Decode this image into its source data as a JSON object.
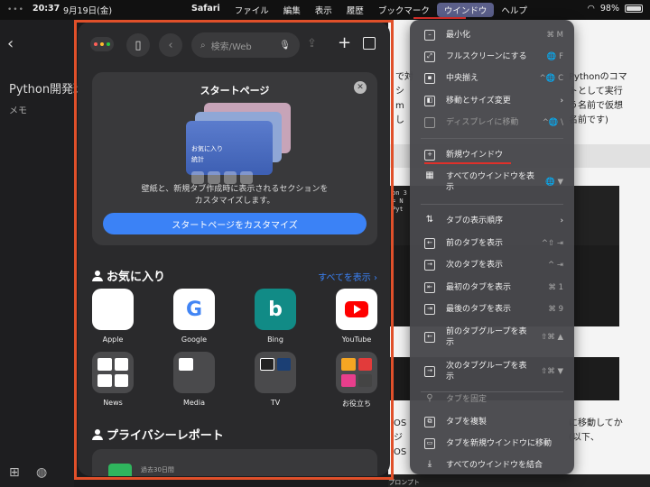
{
  "menubar": {
    "time": "20:37",
    "date": "9月19日(金)",
    "app": "Safari",
    "menus": [
      "ファイル",
      "編集",
      "表示",
      "履歴",
      "ブックマーク",
      "ウインドウ",
      "ヘルプ"
    ],
    "battery": "98%"
  },
  "notes": {
    "title": "Python開発環",
    "subtitle": "メモ"
  },
  "background_page": {
    "line1": "で対",
    "line2": "シ",
    "line3": "m",
    "line4": "し",
    "right1": "Pythonのコマ",
    "right2": "トとして実行",
    "right3": "う名前で仮想",
    "right4": "名前です)",
    "term_line1": "on 3",
    "term_line2": "= N",
    "term_line3": "Pyt",
    "bottom1": "OS",
    "bottom2": "ジ",
    "bottom3": "OS",
    "bottom_right1": "に移動してか",
    "bottom_right2": "(以下、",
    "taskbar_label": "コマンド プロンプト"
  },
  "safari": {
    "search_placeholder": "検索/Web",
    "start_page": {
      "title": "スタートページ",
      "illustration_label1": "お気に入り",
      "illustration_label2": "統計",
      "description_line1": "壁紙と、新規タブ作成時に表示されるセクションを",
      "description_line2": "カスタマイズします。",
      "button": "スタートページをカスタマイズ"
    },
    "favorites": {
      "title": "お気に入り",
      "show_all": "すべてを表示",
      "items": [
        {
          "label": "Apple"
        },
        {
          "label": "Google"
        },
        {
          "label": "Bing"
        },
        {
          "label": "YouTube"
        },
        {
          "label": "News"
        },
        {
          "label": "Media"
        },
        {
          "label": "TV"
        },
        {
          "label": "お役立ち"
        }
      ]
    },
    "privacy": {
      "title": "プライバシーレポート",
      "subtitle": "過去30日間"
    }
  },
  "window_menu": {
    "items": [
      {
        "label": "最小化",
        "shortcut": "⌘ M"
      },
      {
        "label": "フルスクリーンにする",
        "shortcut": "🌐 F"
      },
      {
        "label": "中央揃え",
        "shortcut": "^🌐 C"
      },
      {
        "label": "移動とサイズ変更",
        "shortcut": "›"
      },
      {
        "label": "ディスプレイに移動",
        "shortcut": "^🌐 \\"
      },
      {
        "label": "新規ウインドウ",
        "shortcut": ""
      },
      {
        "label": "すべてのウインドウを表示",
        "shortcut": "🌐 ▼"
      },
      {
        "label": "タブの表示順序",
        "shortcut": "›"
      },
      {
        "label": "前のタブを表示",
        "shortcut": "^⇧ ⇥"
      },
      {
        "label": "次のタブを表示",
        "shortcut": "^ ⇥"
      },
      {
        "label": "最初のタブを表示",
        "shortcut": "⌘ 1"
      },
      {
        "label": "最後のタブを表示",
        "shortcut": "⌘ 9"
      },
      {
        "label": "前のタブグループを表示",
        "shortcut": "⇧⌘ ▲"
      },
      {
        "label": "次のタブグループを表示",
        "shortcut": "⇧⌘ ▼"
      },
      {
        "label": "タブを固定",
        "shortcut": ""
      },
      {
        "label": "タブを複製",
        "shortcut": ""
      },
      {
        "label": "タブを新規ウインドウに移動",
        "shortcut": ""
      },
      {
        "label": "すべてのウインドウを結合",
        "shortcut": ""
      }
    ]
  },
  "colors": {
    "highlight_frame": "#e0502a",
    "underline": "#e0302a",
    "accent": "#3b82f6"
  }
}
